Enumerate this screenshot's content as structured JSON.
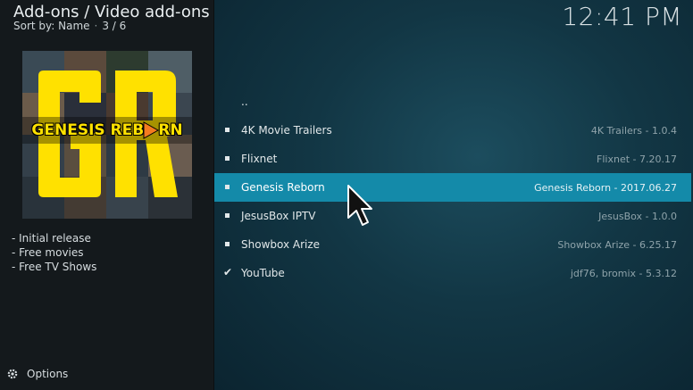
{
  "header": {
    "title": "Add-ons / Video add-ons",
    "sort_label": "Sort by: Name",
    "separator": "·",
    "position": "3 / 6"
  },
  "clock": "12:41 PM",
  "artwork": {
    "logo_letters": "GR",
    "logo_text": "GENESIS REB",
    "logo_text_end": "RN",
    "logo_color": "#ffe100",
    "accent_color": "#f47b20"
  },
  "description": [
    "- Initial release",
    "- Free movies",
    "- Free TV Shows"
  ],
  "options_label": "Options",
  "list": {
    "parent": "..",
    "items": [
      {
        "label": "4K Movie Trailers",
        "version": "4K Trailers - 1.0.4",
        "marker": "bullet",
        "selected": false
      },
      {
        "label": "Flixnet",
        "version": "Flixnet - 7.20.17",
        "marker": "bullet",
        "selected": false
      },
      {
        "label": "Genesis Reborn",
        "version": "Genesis Reborn - 2017.06.27",
        "marker": "bullet",
        "selected": true
      },
      {
        "label": "JesusBox IPTV",
        "version": "JesusBox - 1.0.0",
        "marker": "bullet",
        "selected": false
      },
      {
        "label": "Showbox Arize",
        "version": "Showbox Arize - 6.25.17",
        "marker": "bullet",
        "selected": false
      },
      {
        "label": "YouTube",
        "version": "jdf76, bromix - 5.3.12",
        "marker": "check",
        "selected": false
      }
    ]
  },
  "colors": {
    "selection": "#148aa9",
    "left_panel": "#14191c",
    "right_panel": "#123644"
  }
}
